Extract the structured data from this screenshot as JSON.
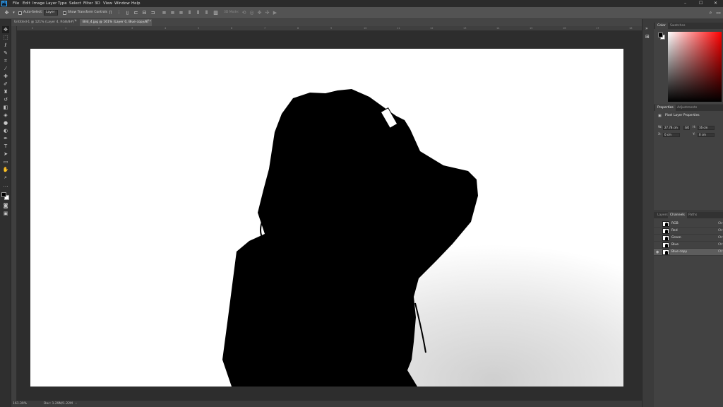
{
  "app": {
    "logo": "Ps"
  },
  "menu": [
    "File",
    "Edit",
    "Image",
    "Layer",
    "Type",
    "Select",
    "Filter",
    "3D",
    "View",
    "Window",
    "Help"
  ],
  "window_controls": {
    "minimize": "–",
    "maximize": "☐",
    "close": "✕"
  },
  "options_bar": {
    "auto_select_label": "Auto-Select:",
    "layer_select": "Layer",
    "transform_controls_label": "Show Transform Controls",
    "mode_label": "3D Mode:"
  },
  "tabs": [
    {
      "label": "Untitled-1 @ 121% (Layer 4, RGB/8#) *",
      "close": "×"
    },
    {
      "label": "Bild_4.jpg @ 161% (Layer 0, Blue copy/8) *",
      "close": "×"
    }
  ],
  "ruler_marks": [
    "0",
    "1",
    "2",
    "3",
    "4",
    "5",
    "6",
    "7",
    "8",
    "9",
    "10",
    "11",
    "12",
    "13",
    "14",
    "15",
    "16",
    "17",
    "18"
  ],
  "status": {
    "zoom": "161.39%",
    "doc": "Doc: 1.29M/1.22M"
  },
  "colors": {
    "canvas_bg": "#ffffff",
    "silhouette": "#000000",
    "accent_red": "#ff0000",
    "ps_blue": "#31a8ff"
  },
  "color_panel": {
    "tabs": [
      "Color",
      "Swatches"
    ]
  },
  "properties_panel": {
    "tabs": [
      "Properties",
      "Adjustments"
    ],
    "title": "Pixel Layer Properties",
    "w_label": "W:",
    "w_value": "27.78 cm",
    "link_label": "GO",
    "h_label": "H:",
    "h_value": "16 cm",
    "x_label": "X:",
    "x_value": "0 cm",
    "y_label": "Y:",
    "y_value": "0 cm"
  },
  "channels_panel": {
    "tabs": [
      "Layers",
      "Channels",
      "Paths"
    ],
    "rows": [
      {
        "name": "RGB",
        "key": "Ctr"
      },
      {
        "name": "Red",
        "key": "Ctr"
      },
      {
        "name": "Green",
        "key": "Ctr"
      },
      {
        "name": "Blue",
        "key": "Ctr"
      },
      {
        "name": "Blue copy",
        "key": "Ctr"
      }
    ]
  }
}
